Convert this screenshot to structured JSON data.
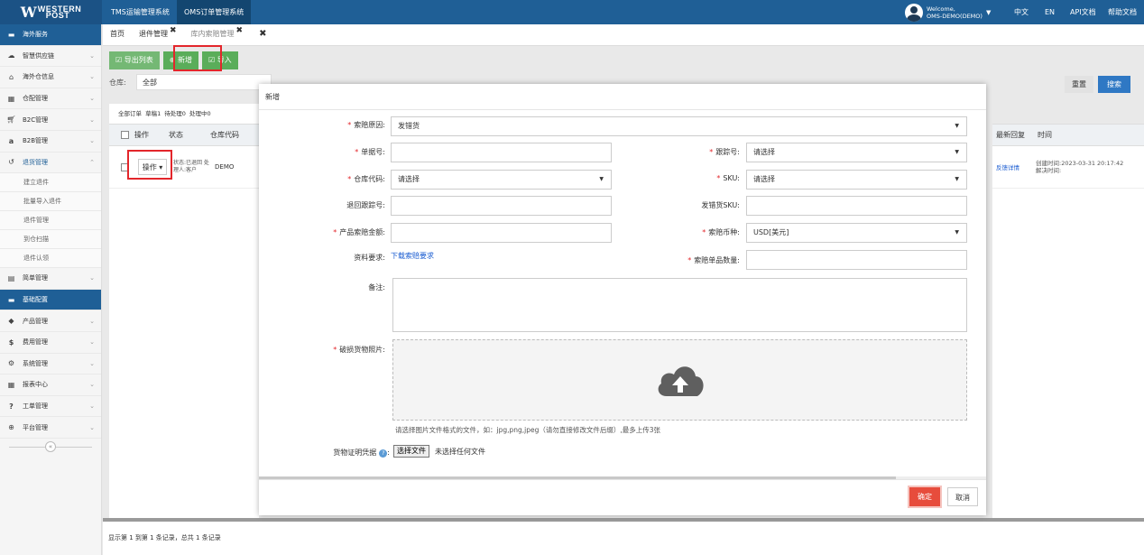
{
  "brand": {
    "line1": "WESTERN",
    "line2": "POST"
  },
  "systems": [
    "TMS运输管理系统",
    "OMS订单管理系统"
  ],
  "user": {
    "welcome": "Welcome,",
    "name": "OMS-DEMO(DEMO)"
  },
  "top_links": [
    "中文",
    "EN",
    "API文档",
    "帮助文档"
  ],
  "sidebar": {
    "items": [
      {
        "label": "海外服务",
        "icon": "folder-icon"
      },
      {
        "label": "智慧供应链",
        "icon": "cloud-icon"
      },
      {
        "label": "海外仓信息",
        "icon": "home-icon"
      },
      {
        "label": "仓配管理",
        "icon": "grid-icon"
      },
      {
        "label": "B2C管理",
        "icon": "cart-icon"
      },
      {
        "label": "B2B管理",
        "icon": "amazon-icon"
      },
      {
        "label": "退货管理",
        "icon": "return-icon"
      }
    ],
    "sub_items": [
      "建立退件",
      "批量导入退件",
      "退件管理",
      "到仓扫描",
      "退件认领"
    ],
    "items2": [
      {
        "label": "简单管理",
        "icon": "doc-icon"
      },
      {
        "label": "基础配置",
        "icon": "folder-icon"
      },
      {
        "label": "产品管理",
        "icon": "tag-icon"
      },
      {
        "label": "费用管理",
        "icon": "dollar-icon"
      },
      {
        "label": "系统管理",
        "icon": "gear-icon"
      },
      {
        "label": "报表中心",
        "icon": "table-icon"
      },
      {
        "label": "工单管理",
        "icon": "question-icon"
      },
      {
        "label": "平台管理",
        "icon": "globe-icon"
      }
    ]
  },
  "tabs": [
    "首页",
    "退件管理",
    "库内索赔管理"
  ],
  "toolbar": {
    "export": "导出列表",
    "add": "新增",
    "import": "导入"
  },
  "filter": {
    "warehouse_label": "仓库:",
    "warehouse_value": "全部",
    "reset": "重置",
    "search": "搜索"
  },
  "list": {
    "status_counts": "全部订单 草稿1 待处理0 处理中0",
    "headers": [
      "操作",
      "状态",
      "仓库代码"
    ],
    "row": {
      "op": "操作",
      "status": "状态:已退回 处理人:客户",
      "warehouse": "DEMO"
    },
    "right_headers": [
      "最新回复",
      "时间"
    ],
    "right_row": {
      "reply": "反馈详情",
      "created": "创建时间:2023-03-31 20:17:42",
      "resolved": "解决时间:"
    }
  },
  "footer": "显示第 1 到第 1 条记录，总共 1 条记录",
  "modal": {
    "title": "新增",
    "reason_label": "索赔原因:",
    "reason_value": "发错货",
    "order_label": "单据号:",
    "track_label": "跟踪号:",
    "track_value": "请选择",
    "wh_label": "仓库代码:",
    "wh_value": "请选择",
    "sku_label": "SKU:",
    "sku_value": "请选择",
    "return_track_label": "退回跟踪号:",
    "wrong_sku_label": "发错货SKU:",
    "amount_label": "产品索赔金额:",
    "currency_label": "索赔币种:",
    "currency_value": "USD[美元]",
    "material_label": "资料要求:",
    "material_link": "下载索赔要求",
    "qty_label": "索赔单品数量:",
    "remark_label": "备注:",
    "photo_label": "破损货物照片:",
    "upload_hint": "请选择图片文件格式的文件，如：jpg,png,jpeg（请勿直接修改文件后缀）,最多上传3张",
    "proof_label": "货物证明凭据",
    "choose_file": "选择文件",
    "no_file": "未选择任何文件",
    "ok": "确定",
    "cancel": "取消"
  }
}
